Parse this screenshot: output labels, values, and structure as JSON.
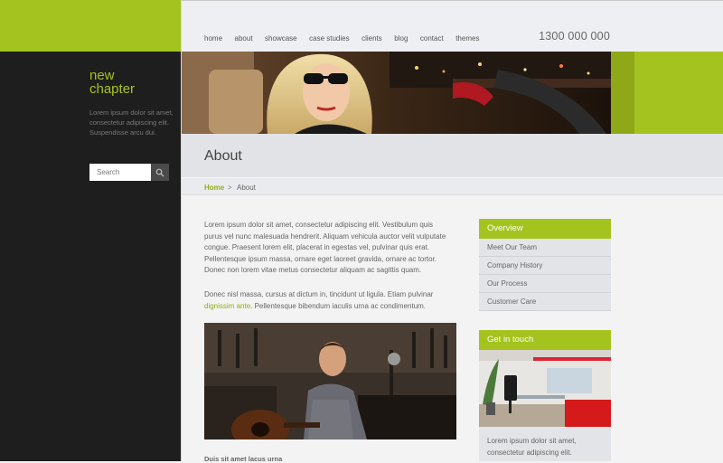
{
  "brand": {
    "line1": "new",
    "line2": "chapter"
  },
  "sidebar": {
    "tagline": "Lorem ipsum dolor sit amet, consectetur adipiscing elit. Suspendisse arcu dui.",
    "search_placeholder": "Search"
  },
  "nav": [
    "home",
    "about",
    "showcase",
    "case studies",
    "clients",
    "blog",
    "contact",
    "themes"
  ],
  "phone": "1300 000 000",
  "page_title": "About",
  "breadcrumb": {
    "home": "Home",
    "separator": ">",
    "current": "About"
  },
  "content": {
    "p1": "Lorem ipsum dolor sit amet, consectetur adipiscing elit. Vestibulum quis purus vel nunc malesuada hendrerit. Aliquam vehicula auctor velit vulputate congue. Praesent lorem elit, placerat in egestas vel, pulvinar quis erat. Pellentesque ipsum massa, ornare eget laoreet gravida, ornare ac tortor. Donec non lorem vitae metus consectetur aliquam ac sagittis quam.",
    "p2_before": "Donec nisl massa, cursus at dictum in, tincidunt ut ligula. Etiam pulvinar ",
    "p2_link": "dignissim ante",
    "p2_after": ". Pellentesque bibendum iaculis urna ac condimentum.",
    "bottom_heading": "Duis sit amet lacus urna"
  },
  "overview": {
    "title": "Overview",
    "items": [
      "Meet Our Team",
      "Company History",
      "Our Process",
      "Customer Care"
    ]
  },
  "get_in_touch": {
    "title": "Get in touch",
    "text": "Lorem ipsum dolor sit amet, consectetur adipiscing elit."
  },
  "colors": {
    "accent": "#a5c31f",
    "sidebar": "#1e1e1e",
    "link": "#8fb012"
  }
}
